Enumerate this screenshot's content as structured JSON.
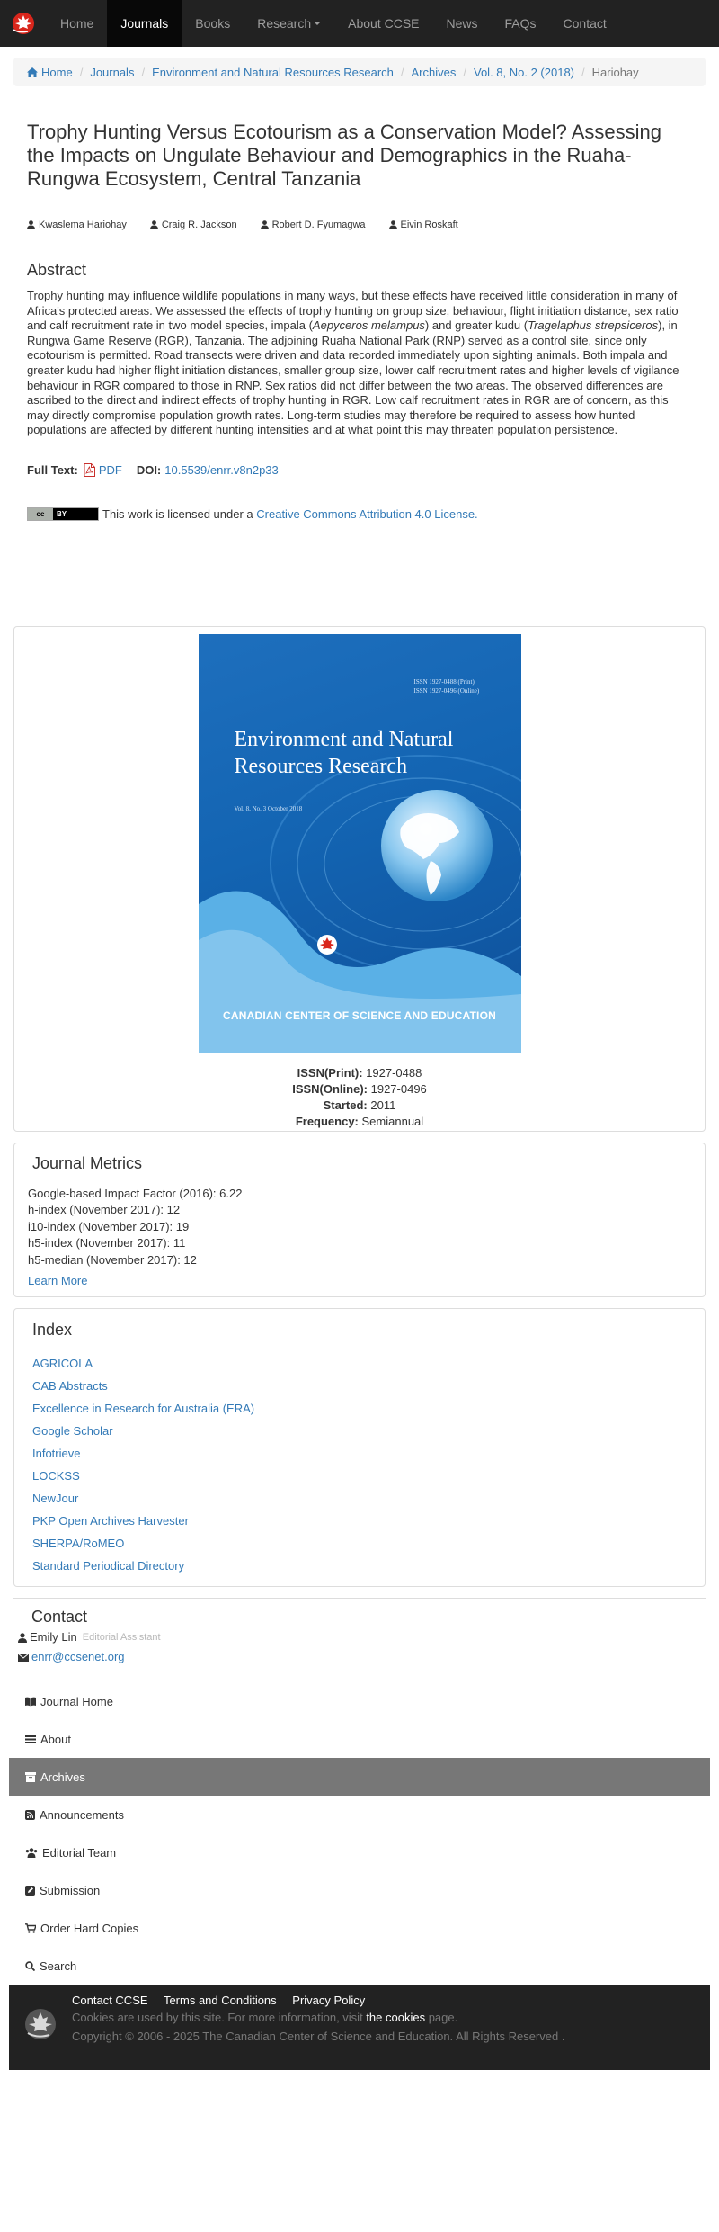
{
  "nav": {
    "items": [
      "Home",
      "Journals",
      "Books",
      "Research",
      "About CCSE",
      "News",
      "FAQs",
      "Contact"
    ],
    "active_index": 1
  },
  "breadcrumb": {
    "home": "Home",
    "journals": "Journals",
    "journal": "Environment and Natural Resources Research",
    "archives": "Archives",
    "issue": "Vol. 8, No. 2 (2018)",
    "current": "Hariohay"
  },
  "article": {
    "title": "Trophy Hunting Versus Ecotourism as a Conservation Model? Assessing the Impacts on Ungulate Behaviour and Demographics in the Ruaha-Rungwa Ecosystem, Central Tanzania",
    "authors": [
      "Kwaslema Hariohay",
      "Craig R. Jackson",
      "Robert D. Fyumagwa",
      "Eivin Roskaft"
    ],
    "abstract_heading": "Abstract",
    "abstract": {
      "p1": "Trophy hunting may influence wildlife populations in many ways, but these effects have received little consideration in many of Africa's protected areas. We assessed the effects of trophy hunting on group size, behaviour, flight initiation distance, sex ratio and calf recruitment rate in two model species, impala (",
      "s1": "Aepyceros melampus",
      "p2": ") and greater kudu (",
      "s2": "Tragelaphus strepsiceros",
      "p3": "), in Rungwa Game Reserve (RGR), Tanzania. The adjoining Ruaha National Park (RNP) served as a control site, since only ecotourism is permitted. Road transects were driven and data recorded immediately upon sighting animals. Both impala and greater kudu had higher flight initiation distances, smaller group size, lower calf recruitment rates and higher levels of vigilance behaviour in RGR compared to those in RNP. Sex ratios did not differ between the two areas. The observed differences are ascribed to the direct and indirect effects of trophy hunting in RGR. Low calf recruitment rates in RGR are of concern, as this may directly compromise population growth rates. Long-term studies may therefore be required to assess how hunted populations are affected by different hunting intensities and at what point this may threaten population persistence."
    },
    "fulltext_label": "Full Text:",
    "pdf_label": "PDF",
    "doi_label": "DOI:",
    "doi_value": "10.5539/enrr.v8n2p33",
    "license_badge_cc": "cc",
    "license_badge_by": "BY",
    "license_text": "This work is licensed under a",
    "license_link": "Creative Commons Attribution 4.0 License."
  },
  "cover": {
    "issn_print_small": "ISSN 1927-0488 (Print)",
    "issn_online_small": "ISSN 1927-0496 (Online)",
    "title_line1": "Environment and Natural",
    "title_line2": "Resources Research",
    "volume": "Vol. 8, No. 3   October 2018",
    "publisher": "CANADIAN CENTER OF SCIENCE AND EDUCATION"
  },
  "journal_info": {
    "issn_print_label": "ISSN(Print):",
    "issn_print": "1927-0488",
    "issn_online_label": "ISSN(Online):",
    "issn_online": "1927-0496",
    "started_label": "Started:",
    "started": "2011",
    "frequency_label": "Frequency:",
    "frequency": "Semiannual"
  },
  "metrics": {
    "heading": "Journal Metrics",
    "items": [
      "Google-based Impact Factor (2016): 6.22",
      "h-index (November 2017): 12",
      "i10-index (November 2017): 19",
      "h5-index (November 2017): 11",
      "h5-median (November 2017): 12"
    ],
    "learn_more": "Learn More"
  },
  "index": {
    "heading": "Index",
    "items": [
      "AGRICOLA",
      "CAB Abstracts",
      "Excellence in Research for Australia (ERA)",
      "Google Scholar",
      "Infotrieve",
      "LOCKSS",
      "NewJour",
      "PKP Open Archives Harvester",
      "SHERPA/RoMEO",
      "Standard Periodical Directory"
    ]
  },
  "contact": {
    "heading": "Contact",
    "name": "Emily Lin",
    "role": "Editorial Assistant",
    "email": "enrr@ccsenet.org"
  },
  "side_nav": {
    "items": [
      "Journal Home",
      "About",
      "Archives",
      "Announcements",
      "Editorial Team",
      "Submission",
      "Order Hard Copies",
      "Search"
    ],
    "active_index": 2
  },
  "footer": {
    "links": [
      "Contact CCSE",
      "Terms and Conditions",
      "Privacy Policy"
    ],
    "cookies_text": "Cookies are used by this site. For more information, visit",
    "cookies_link": "the cookies",
    "cookies_end": "page.",
    "copyright": "Copyright © 2006 - 2025 The Canadian Center of Science and Education. All Rights Reserved ."
  },
  "colors": {
    "navbar": "#222222",
    "link": "#337ab7",
    "active_side": "#777777",
    "cover_blue": "#1364b2",
    "logo_red": "#d9261c"
  }
}
